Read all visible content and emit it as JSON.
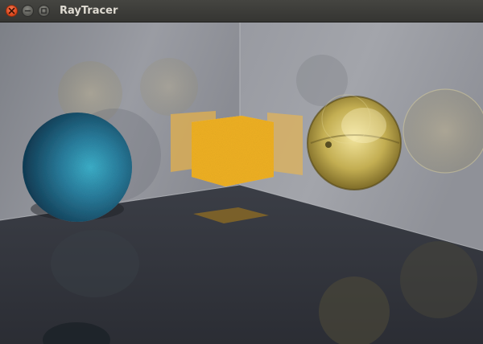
{
  "window": {
    "title": "RayTracer",
    "buttons": {
      "close": "close-icon",
      "minimize": "minimize-icon",
      "maximize": "maximize-icon"
    }
  },
  "scene": {
    "objects": [
      "blue-sphere",
      "yellow-cube",
      "glass-sphere"
    ],
    "colors": {
      "blue_sphere": "#2f86a8",
      "yellow_cube": "#f0b021",
      "glass_sphere": "#c8b55a",
      "walls": "#8e9098",
      "floor": "#30333b"
    }
  }
}
